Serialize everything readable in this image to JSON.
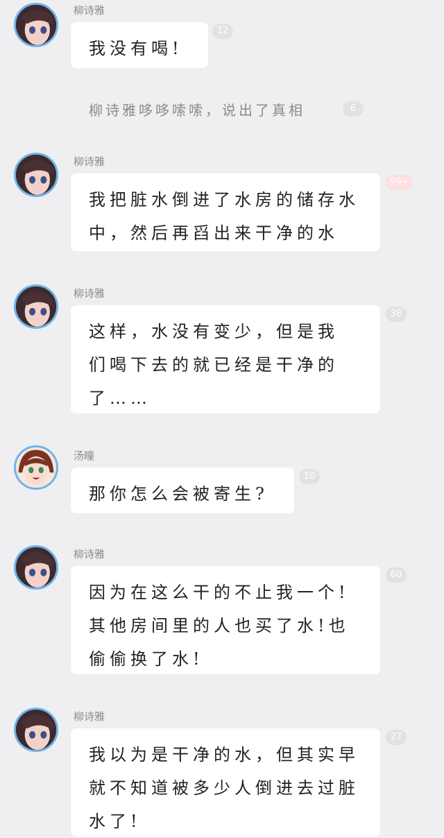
{
  "messages": [
    {
      "sender": "柳诗雅",
      "text": "我没有喝!",
      "badge": "12",
      "avatar": "girl-dark-hair"
    },
    {
      "sender": "柳诗雅",
      "text": "我把脏水倒进了水房的储存水\n中，然后再舀出来干净的水",
      "badge": "99+",
      "avatar": "girl-dark-hair"
    },
    {
      "sender": "柳诗雅",
      "text": "这样，水没有变少，但是我\n们喝下去的就已经是干净的\n了……",
      "badge": "38",
      "avatar": "girl-dark-hair"
    },
    {
      "sender": "汤瞳",
      "text": "那你怎么会被寄生?",
      "badge": "10",
      "avatar": "girl-green-eyes"
    },
    {
      "sender": "柳诗雅",
      "text": "因为在这么干的不止我一个!\n其他房间里的人也买了水!也\n偷偷换了水!",
      "badge": "60",
      "avatar": "girl-dark-hair"
    },
    {
      "sender": "柳诗雅",
      "text": "我以为是干净的水，但其实早\n就不知道被多少人倒进去过脏\n水了!",
      "badge": "27",
      "avatar": "girl-dark-hair"
    }
  ],
  "system_note": {
    "text": "柳诗雅哆哆嗦嗦，说出了真相",
    "badge": "6"
  },
  "colors": {
    "background": "#efeff1",
    "bubble": "#ffffff",
    "avatar_ring": "#6fb3e8",
    "badge": "#e2e2e4",
    "badge_hot": "#fbe0de"
  }
}
